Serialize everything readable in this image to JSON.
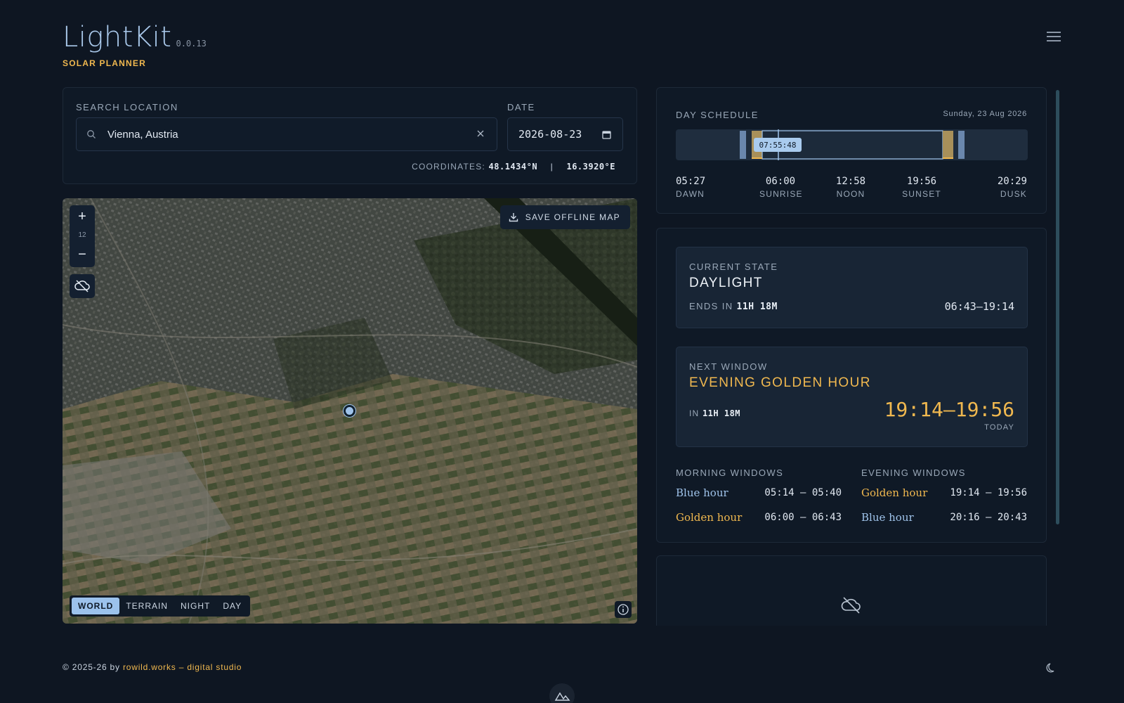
{
  "header": {
    "app_name": "LightKit",
    "version": "0.0.13",
    "subtitle": "SOLAR PLANNER",
    "menu_icon": "hamburger-menu-icon"
  },
  "search": {
    "location_label": "SEARCH LOCATION",
    "location_value": "Vienna, Austria",
    "date_label": "DATE",
    "date_value": "2026-08-23",
    "coordinates_label": "COORDINATES:",
    "latitude": "48.1434°N",
    "separator": "|",
    "longitude": "16.3920°E"
  },
  "map": {
    "zoom_in": "+",
    "zoom_level": "12",
    "zoom_out": "−",
    "save_offline": "SAVE OFFLINE MAP",
    "modes": [
      "WORLD",
      "TERRAIN",
      "NIGHT",
      "DAY"
    ],
    "active_mode": "WORLD"
  },
  "schedule": {
    "title": "DAY SCHEDULE",
    "date": "Sunday, 23 Aug 2026",
    "current_time": "07:55:48",
    "points": [
      {
        "time": "05:27",
        "name": "DAWN"
      },
      {
        "time": "06:00",
        "name": "SUNRISE"
      },
      {
        "time": "12:58",
        "name": "NOON"
      },
      {
        "time": "19:56",
        "name": "SUNSET"
      },
      {
        "time": "20:29",
        "name": "DUSK"
      }
    ]
  },
  "current_state": {
    "caption": "CURRENT STATE",
    "state": "DAYLIGHT",
    "ends_label": "ENDS IN",
    "ends_value": "11H 18M",
    "range": "06:43–19:14"
  },
  "next_window": {
    "caption": "NEXT WINDOW",
    "name": "EVENING GOLDEN HOUR",
    "in_label": "IN",
    "in_value": "11H 18M",
    "range": "19:14–19:56",
    "day": "TODAY"
  },
  "windows": {
    "morning_title": "MORNING WINDOWS",
    "evening_title": "EVENING WINDOWS",
    "morning": [
      {
        "name": "Blue hour",
        "range": "05:14 – 05:40"
      },
      {
        "name": "Golden hour",
        "range": "06:00 – 06:43"
      }
    ],
    "evening": [
      {
        "name": "Golden hour",
        "range": "19:14 – 19:56"
      },
      {
        "name": "Blue hour",
        "range": "20:16 – 20:43"
      }
    ]
  },
  "footer": {
    "copyright": "© 2025-26 by ",
    "studio": "rowild.works – digital studio"
  },
  "colors": {
    "background": "#0e1622",
    "accent_blue": "#9fc3ea",
    "accent_gold": "#f0b84f"
  }
}
